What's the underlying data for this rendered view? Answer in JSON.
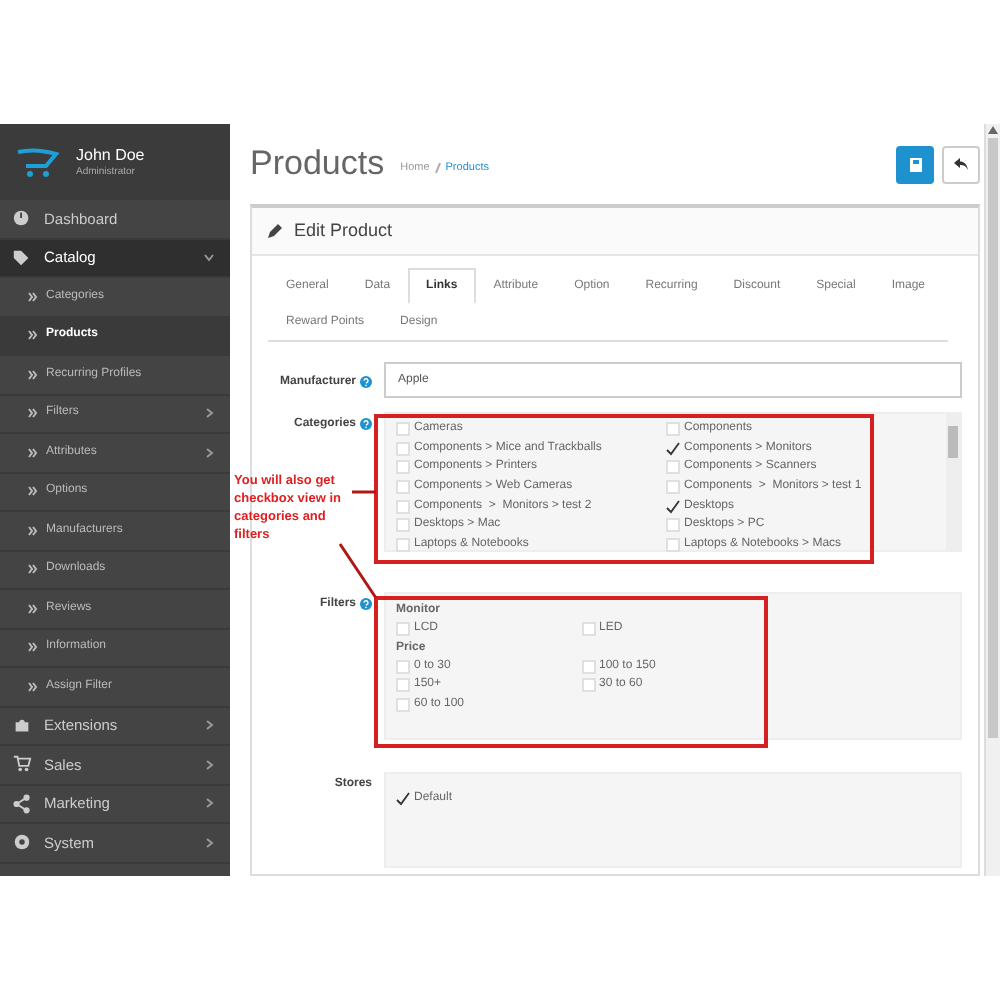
{
  "user": {
    "name": "John Doe",
    "role": "Administrator"
  },
  "sidebar": {
    "items": [
      {
        "label": "Dashboard",
        "expanded": false,
        "arrow": false,
        "selected": false
      },
      {
        "label": "Catalog",
        "expanded": true,
        "arrow": true,
        "selected": true,
        "children": [
          {
            "label": "Categories",
            "selected": false,
            "arrow": false
          },
          {
            "label": "Products",
            "selected": true,
            "arrow": false
          },
          {
            "label": "Recurring Profiles",
            "selected": false,
            "arrow": false
          },
          {
            "label": "Filters",
            "selected": false,
            "arrow": true
          },
          {
            "label": "Attributes",
            "selected": false,
            "arrow": true
          },
          {
            "label": "Options",
            "selected": false,
            "arrow": false
          },
          {
            "label": "Manufacturers",
            "selected": false,
            "arrow": false
          },
          {
            "label": "Downloads",
            "selected": false,
            "arrow": false
          },
          {
            "label": "Reviews",
            "selected": false,
            "arrow": false
          },
          {
            "label": "Information",
            "selected": false,
            "arrow": false
          },
          {
            "label": "Assign Filter",
            "selected": false,
            "arrow": false
          }
        ]
      },
      {
        "label": "Extensions",
        "expanded": false,
        "arrow": true,
        "selected": false
      },
      {
        "label": "Sales",
        "expanded": false,
        "arrow": true,
        "selected": false
      },
      {
        "label": "Marketing",
        "expanded": false,
        "arrow": true,
        "selected": false
      },
      {
        "label": "System",
        "expanded": false,
        "arrow": true,
        "selected": false
      }
    ]
  },
  "page": {
    "title": "Products",
    "breadcrumb": [
      "Home",
      "Products"
    ]
  },
  "panel": {
    "title": "Edit Product"
  },
  "tabs": [
    {
      "label": "General",
      "selected": false
    },
    {
      "label": "Data",
      "selected": false
    },
    {
      "label": "Links",
      "selected": true
    },
    {
      "label": "Attribute",
      "selected": false
    },
    {
      "label": "Option",
      "selected": false
    },
    {
      "label": "Recurring",
      "selected": false
    },
    {
      "label": "Discount",
      "selected": false
    },
    {
      "label": "Special",
      "selected": false
    },
    {
      "label": "Image",
      "selected": false
    },
    {
      "label": "Reward Points",
      "selected": false
    },
    {
      "label": "Design",
      "selected": false
    }
  ],
  "manufacturer": {
    "label": "Manufacturer",
    "value": "Apple"
  },
  "categories": {
    "label": "Categories",
    "items": [
      {
        "label": "Cameras",
        "checked": false
      },
      {
        "label": "Components",
        "checked": false
      },
      {
        "label": "Components > Mice and Trackballs",
        "checked": false
      },
      {
        "label": "Components > Monitors",
        "checked": true
      },
      {
        "label": "Components > Printers",
        "checked": false
      },
      {
        "label": "Components > Scanners",
        "checked": false
      },
      {
        "label": "Components > Web Cameras",
        "checked": false
      },
      {
        "label": "Components  >  Monitors > test 1",
        "checked": false
      },
      {
        "label": "Components  >  Monitors > test 2",
        "checked": false
      },
      {
        "label": "Desktops",
        "checked": true
      },
      {
        "label": "Desktops > Mac",
        "checked": false
      },
      {
        "label": "Desktops > PC",
        "checked": false
      },
      {
        "label": "Laptops & Notebooks",
        "checked": false
      },
      {
        "label": "Laptops & Notebooks > Macs",
        "checked": false
      }
    ]
  },
  "filters": {
    "label": "Filters",
    "groups": [
      {
        "name": "Monitor",
        "items": [
          {
            "label": "LCD",
            "checked": false
          },
          {
            "label": "LED",
            "checked": false
          }
        ]
      },
      {
        "name": "Price",
        "items": [
          {
            "label": "0 to 30",
            "checked": false
          },
          {
            "label": "100 to 150",
            "checked": false
          },
          {
            "label": "150+",
            "checked": false
          },
          {
            "label": "30 to 60",
            "checked": false
          },
          {
            "label": "60 to 100",
            "checked": false
          }
        ]
      }
    ]
  },
  "stores": {
    "label": "Stores",
    "items": [
      {
        "label": "Default",
        "checked": true
      }
    ]
  },
  "annotation": {
    "text": "You will also get checkbox view in categories and filters"
  }
}
